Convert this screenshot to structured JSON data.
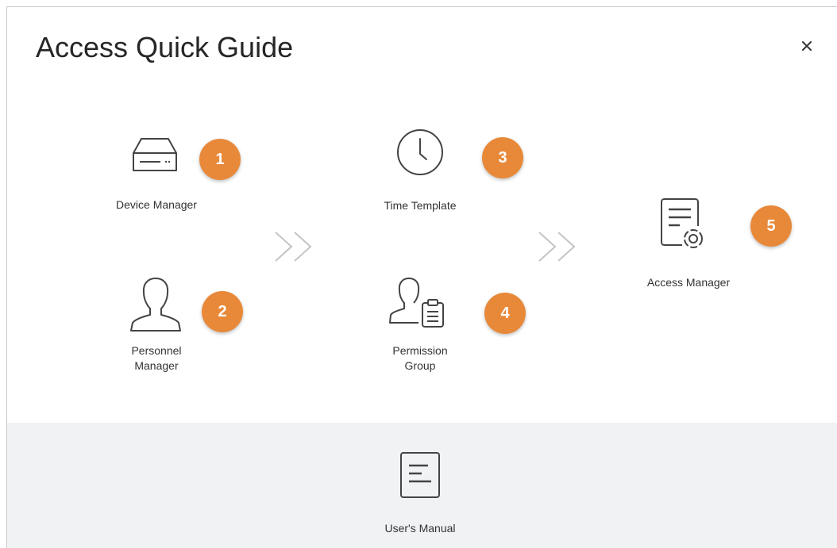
{
  "dialog": {
    "title": "Access Quick Guide",
    "close_glyph": "×"
  },
  "steps": [
    {
      "number": "1",
      "label": "Device Manager",
      "icon": "device-icon"
    },
    {
      "number": "2",
      "label_lines": [
        "Personnel",
        "Manager"
      ],
      "icon": "person-icon"
    },
    {
      "number": "3",
      "label": "Time Template",
      "icon": "clock-icon"
    },
    {
      "number": "4",
      "label_lines": [
        "Permission",
        "Group"
      ],
      "icon": "permission-group-icon"
    },
    {
      "number": "5",
      "label": "Access Manager",
      "icon": "access-manager-icon"
    }
  ],
  "footer": {
    "manual_label": "User's Manual",
    "icon": "document-icon"
  },
  "colors": {
    "badge": "#e8893a",
    "footer_bg": "#f1f2f4",
    "icon_stroke": "#444444",
    "arrow": "#c4c4c4"
  }
}
